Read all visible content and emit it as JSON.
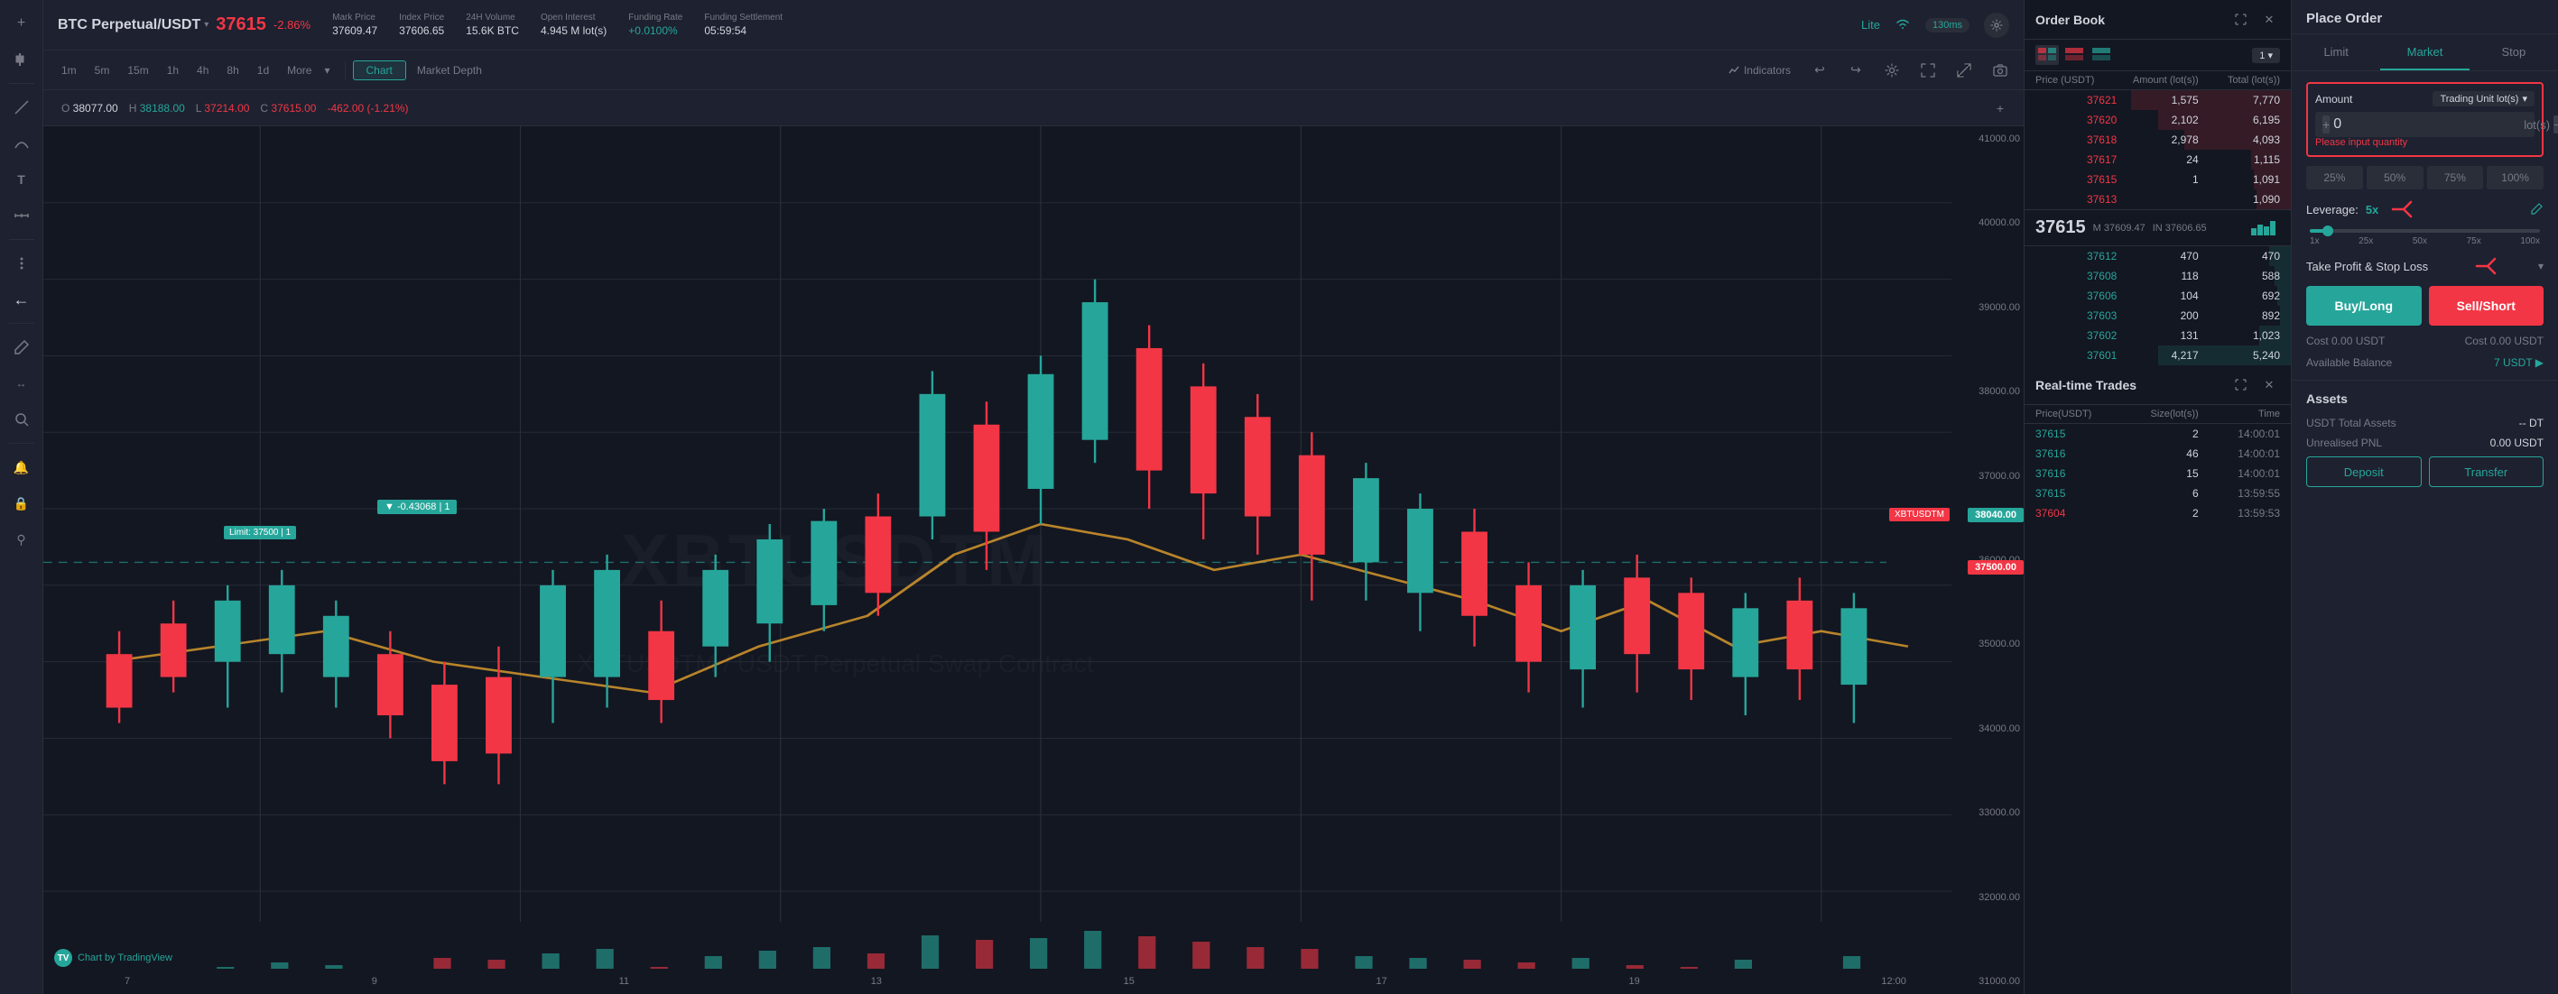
{
  "header": {
    "symbol": "BTC Perpetual/USDT",
    "price": "37615",
    "price_change": "-2.86%",
    "mark_price_label": "Mark Price",
    "mark_price_value": "37609.47",
    "index_price_label": "Index Price",
    "index_price_value": "37606.65",
    "volume_label": "24H Volume",
    "volume_value": "15.6K BTC",
    "open_interest_label": "Open Interest",
    "open_interest_value": "4.945 M lot(s)",
    "funding_rate_label": "Funding Rate",
    "funding_rate_value": "+0.0100%",
    "funding_settle_label": "Funding Settlement",
    "funding_settle_value": "05:59:54",
    "lite_label": "Lite",
    "ping_value": "130ms"
  },
  "chart_toolbar": {
    "timeframes": [
      "1m",
      "5m",
      "15m",
      "1h",
      "4h",
      "8h",
      "1d"
    ],
    "more_label": "More",
    "chart_button_label": "Chart",
    "market_depth_label": "Market Depth",
    "indicators_label": "Indicators"
  },
  "chart_info": {
    "open_label": "O",
    "open_value": "38077.00",
    "high_label": "H",
    "high_value": "38188.00",
    "low_label": "L",
    "low_value": "37214.00",
    "close_label": "C",
    "close_value": "37615.00",
    "change": "-462.00 (-1.21%)",
    "watermark": "XBTUSDTM",
    "subtext": "XBTUSDTM / USDT Perpetual Swap Contract"
  },
  "chart_annotations": {
    "limit_order": "Limit: 37500",
    "limit_qty": "1",
    "limit_direction": "▼ -0.43068",
    "limit_qty2": "1",
    "price_label_green": "38040.00",
    "price_label_red": "37500.00",
    "ticker_label": "XBTUSDTM"
  },
  "chart_prices": {
    "scale": [
      "41000.00",
      "40000.00",
      "39000.00",
      "38000.00",
      "37000.00",
      "36000.00",
      "35000.00",
      "34000.00",
      "33000.00",
      "32000.00",
      "31000.00"
    ],
    "dates": [
      "7",
      "9",
      "11",
      "13",
      "15",
      "17",
      "19",
      "12:00"
    ]
  },
  "tradingview": {
    "badge_text": "Chart by TradingView"
  },
  "orderbook": {
    "title": "Order Book",
    "col_price": "Price (USDT)",
    "col_amount": "Amount (lot(s))",
    "col_total": "Total (lot(s))",
    "precision": "1",
    "asks": [
      {
        "price": "37621",
        "amount": "1,575",
        "total": "7,770",
        "bg_pct": 60
      },
      {
        "price": "37620",
        "amount": "2,102",
        "total": "6,195",
        "bg_pct": 50
      },
      {
        "price": "37618",
        "amount": "2,978",
        "total": "4,093",
        "bg_pct": 40
      },
      {
        "price": "37617",
        "amount": "24",
        "total": "1,115",
        "bg_pct": 15
      },
      {
        "price": "37615",
        "amount": "1",
        "total": "1,091",
        "bg_pct": 14
      },
      {
        "price": "37613",
        "amount": "",
        "total": "1,090",
        "bg_pct": 13
      }
    ],
    "mid_price": "37615",
    "mid_mark": "M 37609.47",
    "mid_index": "IN 37606.65",
    "bids": [
      {
        "price": "37612",
        "amount": "470",
        "total": "470",
        "bg_pct": 8
      },
      {
        "price": "37608",
        "amount": "118",
        "total": "588",
        "bg_pct": 6
      },
      {
        "price": "37606",
        "amount": "104",
        "total": "692",
        "bg_pct": 5
      },
      {
        "price": "37603",
        "amount": "200",
        "total": "892",
        "bg_pct": 4
      },
      {
        "price": "37602",
        "amount": "131",
        "total": "1,023",
        "bg_pct": 12
      },
      {
        "price": "37601",
        "amount": "4,217",
        "total": "5,240",
        "bg_pct": 50
      }
    ]
  },
  "trades": {
    "title": "Real-time Trades",
    "col_price": "Price(USDT)",
    "col_size": "Size(lot(s))",
    "col_time": "Time",
    "rows": [
      {
        "price": "37615",
        "size": "2",
        "time": "14:00:01",
        "color": "green"
      },
      {
        "price": "37616",
        "size": "46",
        "time": "14:00:01",
        "color": "green"
      },
      {
        "price": "37616",
        "size": "15",
        "time": "14:00:01",
        "color": "green"
      },
      {
        "price": "37615",
        "size": "6",
        "time": "13:59:55",
        "color": "green"
      },
      {
        "price": "37604",
        "size": "2",
        "time": "13:59:53",
        "color": "red"
      }
    ]
  },
  "place_order": {
    "title": "Place Order",
    "tab_limit": "Limit",
    "tab_market": "Market",
    "tab_stop": "Stop",
    "amount_label": "Amount",
    "trading_unit_label": "Trading Unit lot(s)",
    "input_value": "0",
    "lot_label": "lot(s)",
    "error_msg": "Please input quantity",
    "pct_buttons": [
      "25%",
      "50%",
      "75%",
      "100%"
    ],
    "leverage_label": "Leverage:",
    "leverage_value": "5x",
    "leverage_marks": [
      "1x",
      "25x",
      "50x",
      "75x",
      "100x"
    ],
    "tp_sl_label": "Take Profit & Stop Loss",
    "buy_label": "Buy/Long",
    "sell_label": "Sell/Short",
    "cost_label": "Cost",
    "cost_buy_val": "0.00 USDT",
    "cost_sell_val": "Cost  0.00 USDT",
    "available_label": "Available Balance",
    "available_val": "7 USDT ▶"
  },
  "assets": {
    "title": "Assets",
    "total_label": "USDT Total Assets",
    "total_val": "-- DT",
    "pnl_label": "Unrealised PNL",
    "pnl_val": "0.00 USDT",
    "deposit_label": "Deposit",
    "transfer_label": "Transfer"
  },
  "icons": {
    "crosshair": "⊹",
    "candle_type": "⬛",
    "undo": "↩",
    "redo": "↪",
    "settings": "⚙",
    "fullscreen": "⛶",
    "camera": "📷",
    "expand": "⤢",
    "close": "✕",
    "chevron_down": "▾",
    "chevron_right": "▸",
    "edit": "✎",
    "arrow_left": "←",
    "magnet": "⚲",
    "ruler": "📏",
    "zoom": "🔍",
    "lock": "🔒",
    "bell": "🔔",
    "bars": "≡",
    "wifi": "📶"
  }
}
